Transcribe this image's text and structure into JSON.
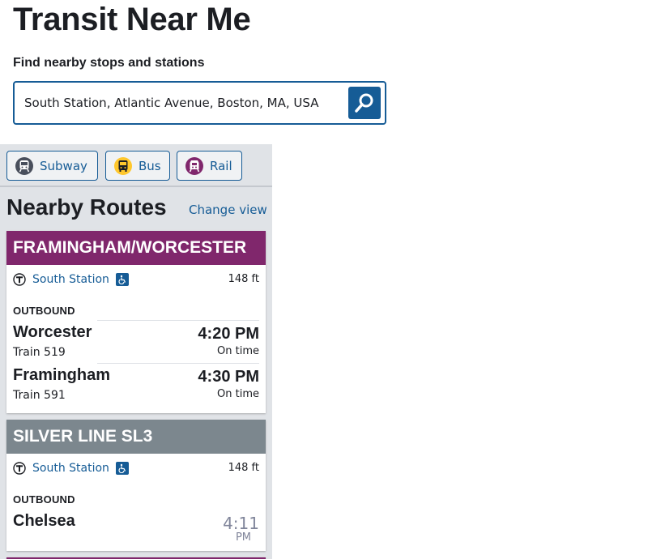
{
  "page": {
    "title": "Transit Near Me"
  },
  "search": {
    "label": "Find nearby stops and stations",
    "value": "South Station, Atlantic Avenue, Boston, MA, USA",
    "button_icon": "search-icon"
  },
  "mode_filters": [
    {
      "label": "Subway",
      "icon": "subway-icon",
      "color": "#494f5c"
    },
    {
      "label": "Bus",
      "icon": "bus-icon",
      "color": "#ffc72c"
    },
    {
      "label": "Rail",
      "icon": "commuter-rail-icon",
      "color": "#80276c"
    }
  ],
  "routes_section": {
    "title": "Nearby Routes",
    "change_view": "Change view"
  },
  "routes": [
    {
      "name": "FRAMINGHAM/WORCESTER",
      "color": "#80276c",
      "stop": "South Station",
      "distance": "148 ft",
      "direction": "OUTBOUND",
      "trips": [
        {
          "destination": "Worcester",
          "train": "Train 519",
          "time": "4:20 PM",
          "status": "On time"
        },
        {
          "destination": "Framingham",
          "train": "Train 591",
          "time": "4:30 PM",
          "status": "On time"
        }
      ]
    },
    {
      "name": "SILVER LINE SL3",
      "color": "#7c878e",
      "stop": "South Station",
      "distance": "148 ft",
      "direction": "OUTBOUND",
      "trips": [
        {
          "destination": "Chelsea",
          "eta_time": "4:11",
          "eta_unit": "PM"
        }
      ]
    }
  ],
  "colors": {
    "link": "#165c96",
    "panel_bg": "#e0e3e7",
    "commuter_rail": "#80276c",
    "silver_line": "#7c878e"
  }
}
